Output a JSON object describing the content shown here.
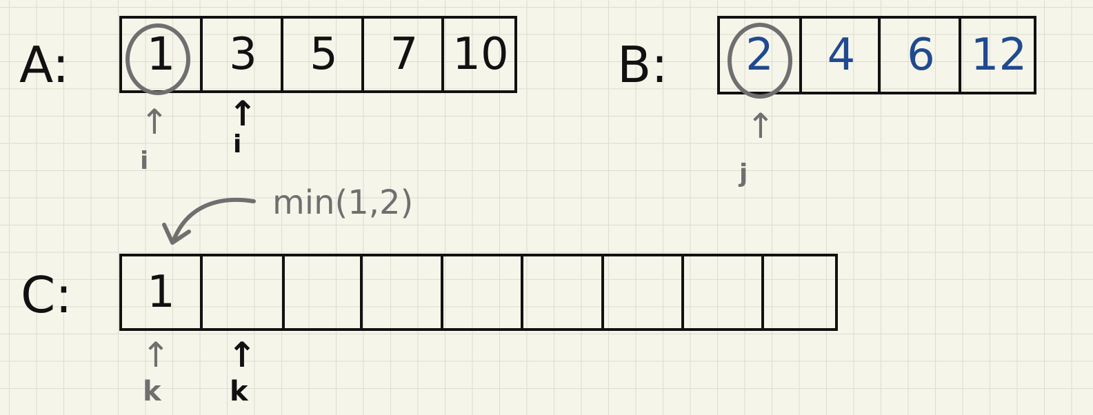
{
  "array_a": {
    "label": "A:",
    "cells": [
      "1",
      "3",
      "5",
      "7",
      "10"
    ]
  },
  "array_b": {
    "label": "B:",
    "cells": [
      "2",
      "4",
      "6",
      "12"
    ]
  },
  "array_c": {
    "label": "C:",
    "cells": [
      "1",
      "",
      "",
      "",
      "",
      "",
      "",
      "",
      ""
    ]
  },
  "pointers": {
    "i_old": "i",
    "i_new": "i",
    "j": "j",
    "k_old": "k",
    "k_new": "k",
    "arrow_glyph": "↑"
  },
  "annotation": {
    "min_text": "min(1,2)"
  },
  "colors": {
    "ink": "#111111",
    "blue": "#1f4a8f",
    "gray": "#6f6f6f",
    "paper": "#f6f5ea",
    "grid": "#dcdccf"
  }
}
